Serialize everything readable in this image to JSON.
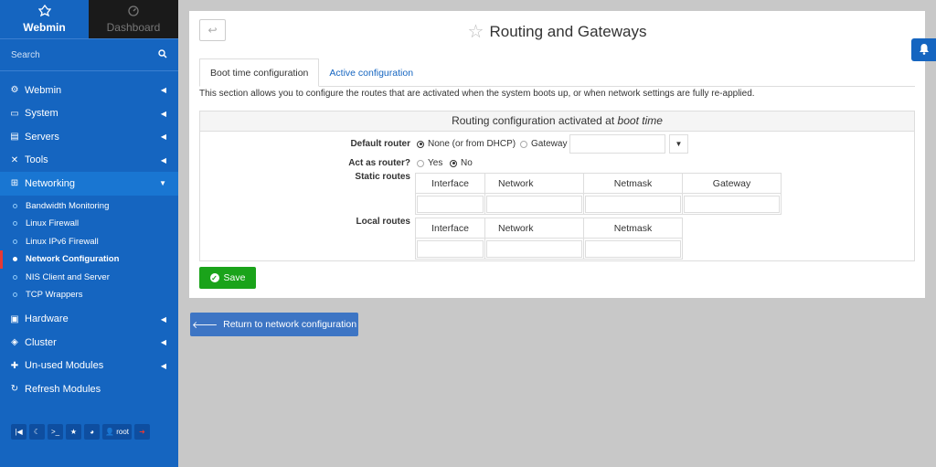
{
  "sidebar": {
    "tab_webmin": "Webmin",
    "tab_dashboard": "Dashboard",
    "search_placeholder": "Search",
    "items": [
      {
        "label": "Webmin"
      },
      {
        "label": "System"
      },
      {
        "label": "Servers"
      },
      {
        "label": "Tools"
      },
      {
        "label": "Networking"
      },
      {
        "label": "Hardware"
      },
      {
        "label": "Cluster"
      },
      {
        "label": "Un-used Modules"
      },
      {
        "label": "Refresh Modules"
      }
    ],
    "networking_subitems": [
      {
        "label": "Bandwidth Monitoring"
      },
      {
        "label": "Linux Firewall"
      },
      {
        "label": "Linux IPv6 Firewall"
      },
      {
        "label": "Network Configuration"
      },
      {
        "label": "NIS Client and Server"
      },
      {
        "label": "TCP Wrappers"
      }
    ],
    "bottom": {
      "user": "root"
    }
  },
  "page": {
    "title": "Routing and Gateways",
    "tabs": [
      {
        "label": "Boot time configuration"
      },
      {
        "label": "Active configuration"
      }
    ],
    "description": "This section allows you to configure the routes that are activated when the system boots up, or when network settings are fully re-applied.",
    "form": {
      "heading_prefix": "Routing configuration activated at",
      "heading_emph": "boot time",
      "default_router_label": "Default router",
      "opt_none": "None (or from DHCP)",
      "opt_gateway": "Gateway",
      "act_as_router_label": "Act as router?",
      "opt_yes": "Yes",
      "opt_no": "No",
      "static_routes_label": "Static routes",
      "local_routes_label": "Local routes",
      "col_interface": "Interface",
      "col_network": "Network",
      "col_netmask": "Netmask",
      "col_gateway": "Gateway"
    },
    "save_label": "Save",
    "return_label": "Return to network configuration"
  },
  "colors": {
    "sidebar": "#1565c0",
    "save": "#1aa31a",
    "return": "#3d75c4"
  }
}
